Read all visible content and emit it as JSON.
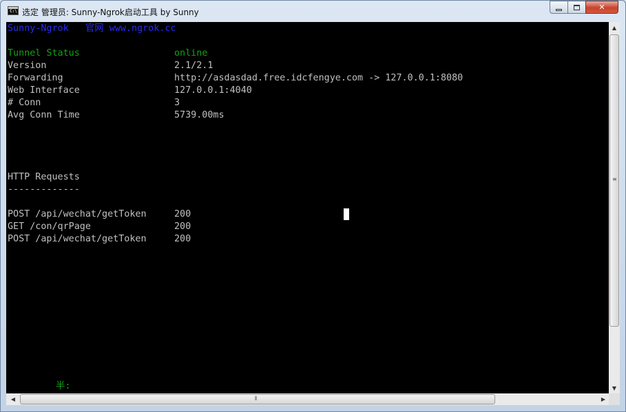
{
  "window": {
    "title": "选定 管理员:  Sunny-Ngrok启动工具 by Sunny",
    "icon": "console-icon",
    "icon_text": "C:\\",
    "controls": {
      "minimize": "minimize-icon",
      "maximize": "maximize-icon",
      "close": "✕"
    }
  },
  "console": {
    "header": {
      "brand": "Sunny-Ngrok",
      "site_label": "官网",
      "site_url": "www.ngrok.cc"
    },
    "status": [
      {
        "key": "Tunnel Status",
        "value": "online"
      },
      {
        "key": "Version",
        "value": "2.1/2.1"
      },
      {
        "key": "Forwarding",
        "value": "http://asdasdad.free.idcfengye.com -> 127.0.0.1:8080"
      },
      {
        "key": "Web Interface",
        "value": "127.0.0.1:4040"
      },
      {
        "key": "# Conn",
        "value": "3"
      },
      {
        "key": "Avg Conn Time",
        "value": "5739.00ms"
      }
    ],
    "requests_title": "HTTP Requests",
    "requests_rule": "-------------",
    "requests": [
      {
        "request": "POST /api/wechat/getToken",
        "status": "200"
      },
      {
        "request": "GET /con/qrPage",
        "status": "200"
      },
      {
        "request": "POST /api/wechat/getToken",
        "status": "200"
      }
    ],
    "ime_indicator": "半:"
  },
  "colors": {
    "background": "#000000",
    "text": "#c0c0c0",
    "header": "#2a2af0",
    "status_online": "#11a411"
  }
}
